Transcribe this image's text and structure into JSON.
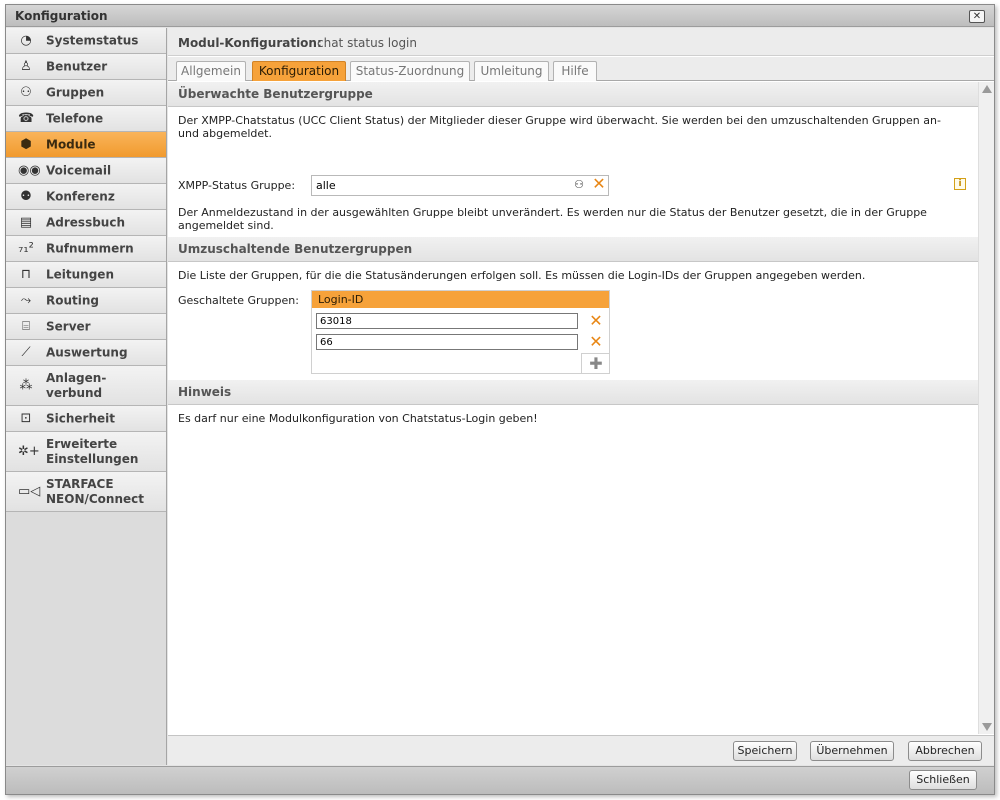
{
  "window": {
    "title": "Konfiguration",
    "close_symbol": "✕",
    "close_button_label": "Schließen"
  },
  "sidebar": {
    "items": [
      {
        "label": "Systemstatus",
        "icon": "clock-icon",
        "glyph": "◔"
      },
      {
        "label": "Benutzer",
        "icon": "user-icon",
        "glyph": "♙"
      },
      {
        "label": "Gruppen",
        "icon": "group-icon",
        "glyph": "⚇"
      },
      {
        "label": "Telefone",
        "icon": "phone-icon",
        "glyph": "☎"
      },
      {
        "label": "Module",
        "icon": "module-cube-icon",
        "glyph": "⬢",
        "active": true
      },
      {
        "label": "Voicemail",
        "icon": "voicemail-icon",
        "glyph": "◉◉"
      },
      {
        "label": "Konferenz",
        "icon": "conference-icon",
        "glyph": "⚉"
      },
      {
        "label": "Adressbuch",
        "icon": "address-book-icon",
        "glyph": "▤"
      },
      {
        "label": "Rufnummern",
        "icon": "numbers-icon",
        "glyph": "₇₁²"
      },
      {
        "label": "Leitungen",
        "icon": "lines-plug-icon",
        "glyph": "⊓"
      },
      {
        "label": "Routing",
        "icon": "routing-icon",
        "glyph": "⤳"
      },
      {
        "label": "Server",
        "icon": "server-icon",
        "glyph": "⌸"
      },
      {
        "label": "Auswertung",
        "icon": "chart-icon",
        "glyph": "⟋"
      },
      {
        "label": "Anlagen-\nverbund",
        "icon": "network-icon",
        "glyph": "⁂"
      },
      {
        "label": "Sicherheit",
        "icon": "lock-icon",
        "glyph": "⊡"
      },
      {
        "label": "Erweiterte\nEinstellungen",
        "icon": "settings-plus-icon",
        "glyph": "✲+"
      },
      {
        "label": "STARFACE\nNEON/Connect",
        "icon": "video-camera-icon",
        "glyph": "▭◁"
      }
    ]
  },
  "module_header": {
    "label": "Modul-Konfiguration:",
    "value": "chat status login"
  },
  "tabs": [
    {
      "label": "Allgemein"
    },
    {
      "label": "Konfiguration",
      "active": true
    },
    {
      "label": "Status-Zuordnung"
    },
    {
      "label": "Umleitung"
    },
    {
      "label": "Hilfe"
    }
  ],
  "section1": {
    "title": "Überwachte Benutzergruppe",
    "description": "Der XMPP-Chatstatus (UCC Client Status) der Mitglieder dieser Gruppe wird überwacht. Sie werden bei den umzuschaltenden Gruppen an- und abgemeldet.",
    "xmpp_label": "XMPP-Status Gruppe:",
    "xmpp_value": "alle",
    "note": "Der Anmeldezustand in der ausgewählten Gruppe bleibt unverändert. Es werden nur die Status der Benutzer gesetzt, die in der Gruppe angemeldet sind."
  },
  "section2": {
    "title": "Umzuschaltende Benutzergruppen",
    "description": "Die Liste der Gruppen, für die die Statusänderungen erfolgen soll. Es müssen die Login-IDs der Gruppen angegeben werden.",
    "groups_label": "Geschaltete Gruppen:",
    "table_header": "Login-ID",
    "rows": [
      "63018",
      "66"
    ]
  },
  "section3": {
    "title": "Hinweis",
    "text": "Es darf nur eine Modulkonfiguration von Chatstatus-Login geben!"
  },
  "buttons": {
    "save": "Speichern",
    "apply": "Übernehmen",
    "cancel": "Abbrechen"
  },
  "colors": {
    "accent": "#f6a23a",
    "delete_x": "#e88614"
  }
}
